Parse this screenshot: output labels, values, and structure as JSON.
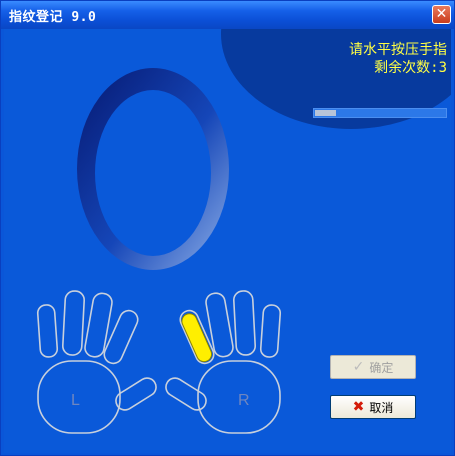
{
  "window": {
    "title": "指纹登记 9.0",
    "close_label": "✕"
  },
  "prompt": {
    "line1": "请水平按压手指",
    "line2": "剩余次数:3"
  },
  "progress": {
    "fraction": 0.16
  },
  "hands": {
    "left_label": "L",
    "right_label": "R",
    "active_finger": "right-index"
  },
  "buttons": {
    "ok_label": "确定",
    "cancel_label": "取消"
  },
  "icons": {
    "ok": "check-icon",
    "cancel": "cancel-x-icon",
    "close": "close-icon"
  },
  "colors": {
    "highlight_finger": "#ffef00",
    "prompt_text": "#ffff44"
  }
}
